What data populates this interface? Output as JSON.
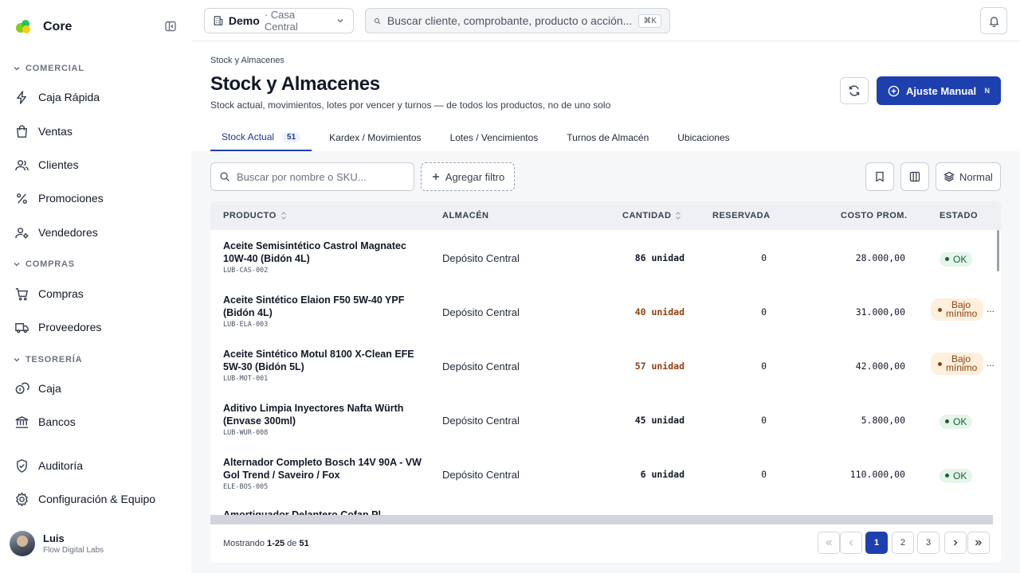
{
  "app": {
    "brand": "Core"
  },
  "sidebar": {
    "sections": [
      {
        "label": "COMERCIAL"
      },
      {
        "label": "COMPRAS"
      },
      {
        "label": "TESORERÍA"
      }
    ],
    "items": [
      {
        "label": "Caja Rápida"
      },
      {
        "label": "Ventas"
      },
      {
        "label": "Clientes"
      },
      {
        "label": "Promociones"
      },
      {
        "label": "Vendedores"
      },
      {
        "label": "Compras"
      },
      {
        "label": "Proveedores"
      },
      {
        "label": "Caja"
      },
      {
        "label": "Bancos"
      },
      {
        "label": "Auditoría"
      },
      {
        "label": "Configuración & Equipo"
      }
    ],
    "user": {
      "name": "Luis",
      "org": "Flow Digital Labs"
    }
  },
  "topbar": {
    "tenant_name": "Demo",
    "tenant_sub": "· Casa Central",
    "search_placeholder": "Buscar cliente, comprobante, producto o acción...",
    "search_shortcut": "⌘K"
  },
  "page": {
    "breadcrumb": "Stock y Almacenes",
    "title": "Stock y Almacenes",
    "subtitle": "Stock actual, movimientos, lotes por vencer y turnos — de todos los productos, no de uno solo",
    "primary_label": "Ajuste Manual",
    "primary_shortcut": "N"
  },
  "tabs": [
    {
      "label": "Stock Actual",
      "count": "51",
      "active": true
    },
    {
      "label": "Kardex / Movimientos"
    },
    {
      "label": "Lotes / Vencimientos"
    },
    {
      "label": "Turnos de Almacén"
    },
    {
      "label": "Ubicaciones"
    }
  ],
  "toolbar": {
    "filter_placeholder": "Buscar por nombre o SKU...",
    "add_filter": "Agregar filtro",
    "density": "Normal"
  },
  "table": {
    "columns": [
      "PRODUCTO",
      "ALMACÉN",
      "CANTIDAD",
      "RESERVADA",
      "COSTO PROM.",
      "ESTADO"
    ],
    "rows": [
      {
        "name": "Aceite Semisintético Castrol Magnatec 10W-40 (Bidón 4L)",
        "sku": "LUB-CAS-002",
        "warehouse": "Depósito Central",
        "qty": "86 unidad",
        "low": false,
        "reserved": "0",
        "cost": "28.000,00",
        "status": "OK"
      },
      {
        "name": "Aceite Sintético Elaion F50 5W-40 YPF (Bidón 4L)",
        "sku": "LUB-ELA-003",
        "warehouse": "Depósito Central",
        "qty": "40 unidad",
        "low": true,
        "reserved": "0",
        "cost": "31.000,00",
        "status": "Bajo mínimo"
      },
      {
        "name": "Aceite Sintético Motul 8100 X-Clean EFE 5W-30 (Bidón 5L)",
        "sku": "LUB-MOT-001",
        "warehouse": "Depósito Central",
        "qty": "57 unidad",
        "low": true,
        "reserved": "0",
        "cost": "42.000,00",
        "status": "Bajo mínimo"
      },
      {
        "name": "Aditivo Limpia Inyectores Nafta Würth (Envase 300ml)",
        "sku": "LUB-WUR-008",
        "warehouse": "Depósito Central",
        "qty": "45 unidad",
        "low": false,
        "reserved": "0",
        "cost": "5.800,00",
        "status": "OK"
      },
      {
        "name": "Alternador Completo Bosch 14V 90A - VW Gol Trend / Saveiro / Fox",
        "sku": "ELE-BOS-005",
        "warehouse": "Depósito Central",
        "qty": "6 unidad",
        "low": false,
        "reserved": "0",
        "cost": "110.000,00",
        "status": "OK"
      },
      {
        "name": "Amortiguador Delantero Cofap Pl...",
        "sku": "",
        "warehouse": "",
        "qty": "",
        "low": false,
        "reserved": "",
        "cost": "",
        "status": ""
      }
    ],
    "more_glyph": "..."
  },
  "pagination": {
    "prefix": "Mostrando",
    "range": "1-25",
    "of": "de",
    "total": "51",
    "pages": [
      "1",
      "2",
      "3"
    ]
  },
  "colors": {
    "primary": "#1e40af",
    "ok_bg": "#e6f4ea",
    "low_bg": "#fdf0dc"
  }
}
